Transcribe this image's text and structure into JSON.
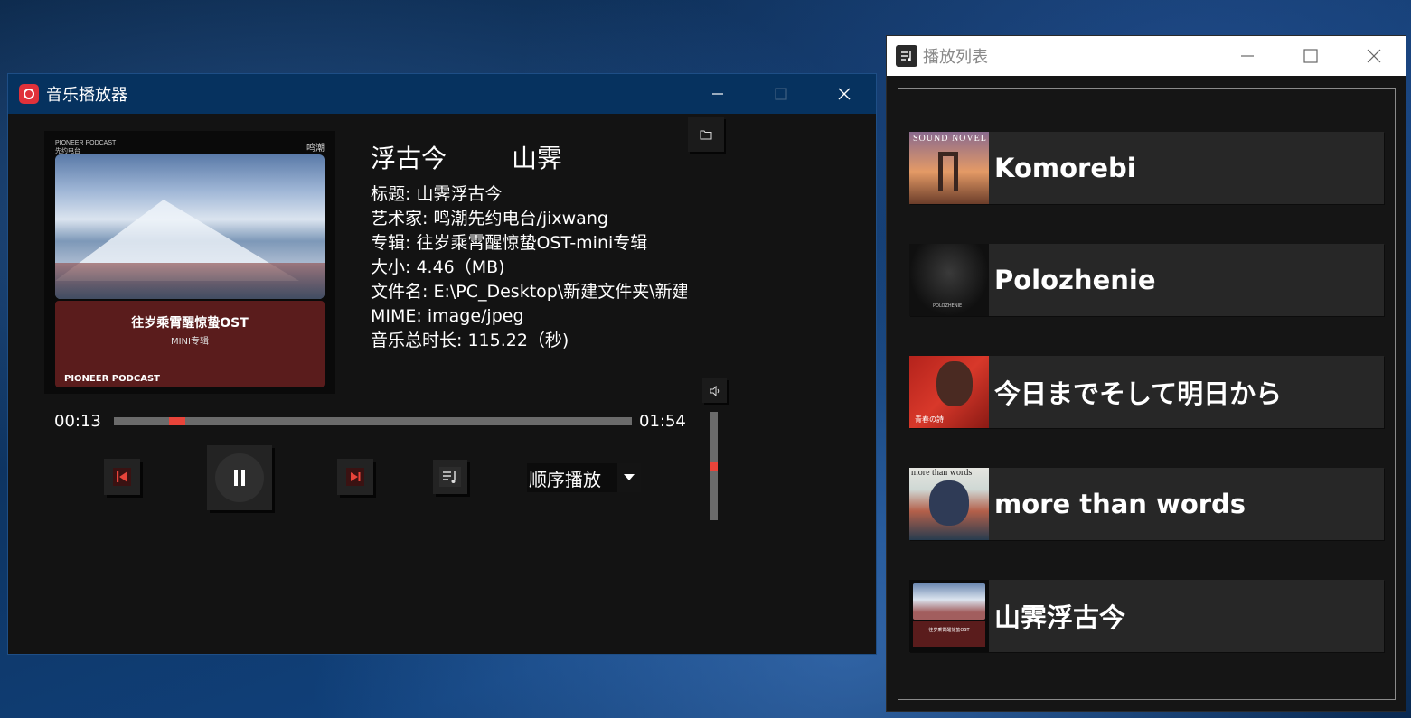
{
  "player": {
    "title": "音乐播放器",
    "cover": {
      "top_left": "PIONEER PODCAST",
      "top_left_sub": "先约电台",
      "top_right": "鸣潮",
      "album_big": "往岁乘霄醒惊蛰OST",
      "album_small": "MINI专辑",
      "logo": "PIONEER PODCAST"
    },
    "headline_title": "浮古今",
    "headline_artist": "山霁",
    "info": {
      "title": "标题: 山霁浮古今",
      "artist": "艺术家: 鸣潮先约电台/jixwang",
      "album": "专辑: 往岁乘霄醒惊蛰OST-mini专辑",
      "size": "大小: 4.46（MB)",
      "filename": "文件名: E:\\PC_Desktop\\新建文件夹\\新建",
      "mime": "MIME: image/jpeg",
      "duration": "音乐总时长: 115.22（秒)"
    },
    "current_time": "00:13",
    "total_time": "01:54",
    "progress": 0.11,
    "volume": 0.5,
    "play_mode": "顺序播放",
    "accent_color": "#e8443a"
  },
  "playlist": {
    "title": "播放列表",
    "tracks": [
      {
        "name": "Komorebi",
        "thumb_caption": "SOUND NOVEL"
      },
      {
        "name": "Polozhenie",
        "thumb_caption": "POLOZHENIE"
      },
      {
        "name": "今日までそして明日から",
        "thumb_caption": "青春の詩"
      },
      {
        "name": "more than words",
        "thumb_caption": "more than words"
      },
      {
        "name": "山霁浮古今",
        "thumb_caption": "往岁乘霄醒惊蛰OST"
      }
    ]
  },
  "icons": {
    "app": "netease-music-icon",
    "folder": "folder-icon",
    "volume": "speaker-icon",
    "prev": "skip-previous-icon",
    "pause": "pause-icon",
    "next": "skip-next-icon",
    "playlist": "playlist-icon",
    "dropdown": "caret-down-icon"
  }
}
